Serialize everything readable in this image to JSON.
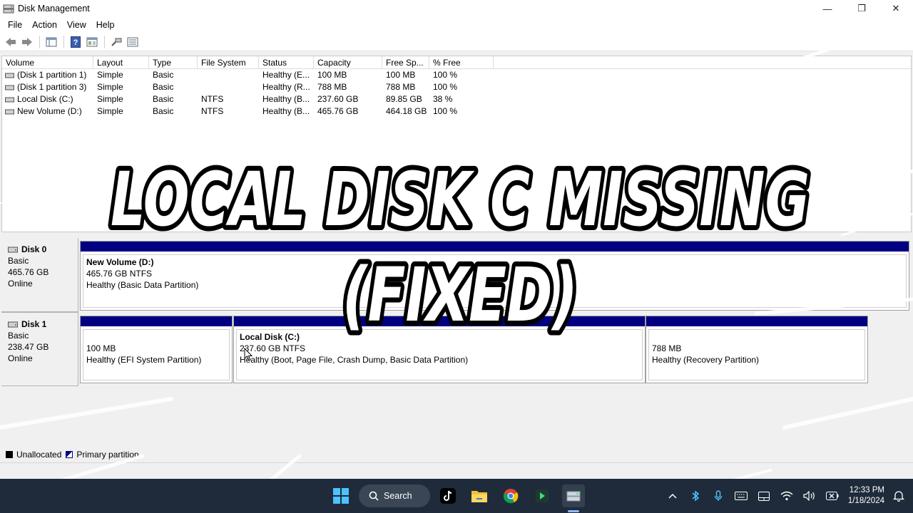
{
  "window": {
    "title": "Disk Management",
    "minimize_glyph": "—",
    "maximize_glyph": "❐",
    "close_glyph": "✕"
  },
  "menu": {
    "items": [
      "File",
      "Action",
      "View",
      "Help"
    ]
  },
  "toolbar": {
    "icons": [
      "back-arrow-icon",
      "forward-arrow-icon",
      "properties-list-icon",
      "help-icon",
      "console-tree-icon",
      "connect-disk-icon",
      "volume-list-icon"
    ]
  },
  "volume_table": {
    "columns": [
      "Volume",
      "Layout",
      "Type",
      "File System",
      "Status",
      "Capacity",
      "Free Sp...",
      "% Free"
    ],
    "rows": [
      [
        "(Disk 1 partition 1)",
        "Simple",
        "Basic",
        "",
        "Healthy (E...",
        "100 MB",
        "100 MB",
        "100 %"
      ],
      [
        "(Disk 1 partition 3)",
        "Simple",
        "Basic",
        "",
        "Healthy (R...",
        "788 MB",
        "788 MB",
        "100 %"
      ],
      [
        "Local Disk (C:)",
        "Simple",
        "Basic",
        "NTFS",
        "Healthy (B...",
        "237.60 GB",
        "89.85 GB",
        "38 %"
      ],
      [
        "New Volume (D:)",
        "Simple",
        "Basic",
        "NTFS",
        "Healthy (B...",
        "465.76 GB",
        "464.18 GB",
        "100 %"
      ]
    ]
  },
  "disks": [
    {
      "name": "Disk 0",
      "type": "Basic",
      "size": "465.76 GB",
      "status": "Online",
      "partitions": [
        {
          "name": "New Volume  (D:)",
          "size": "465.76 GB NTFS",
          "status": "Healthy (Basic Data Partition)"
        }
      ]
    },
    {
      "name": "Disk 1",
      "type": "Basic",
      "size": "238.47 GB",
      "status": "Online",
      "partitions": [
        {
          "name": "",
          "size": "100 MB",
          "status": "Healthy (EFI System Partition)"
        },
        {
          "name": "Local Disk  (C:)",
          "size": "237.60 GB NTFS",
          "status": "Healthy (Boot, Page File, Crash Dump, Basic Data Partition)"
        },
        {
          "name": "",
          "size": "788 MB",
          "status": "Healthy (Recovery Partition)"
        }
      ]
    }
  ],
  "legend": {
    "unallocated": "Unallocated",
    "primary": "Primary partition"
  },
  "overlay_caption": {
    "line1": "LOCAL DISK C MISSING",
    "line2": "(FIXED)"
  },
  "taskbar": {
    "search_label": "Search",
    "pinned": [
      "windows-start-icon",
      "search-icon",
      "tiktok-icon",
      "file-explorer-icon",
      "chrome-icon",
      "store-app-icon",
      "disk-management-icon"
    ],
    "clock_time": "12:33 PM",
    "clock_date": "1/18/2024"
  },
  "colors": {
    "primary_partition_bar": "#000080",
    "taskbar_bg": "#1f2b3a"
  }
}
